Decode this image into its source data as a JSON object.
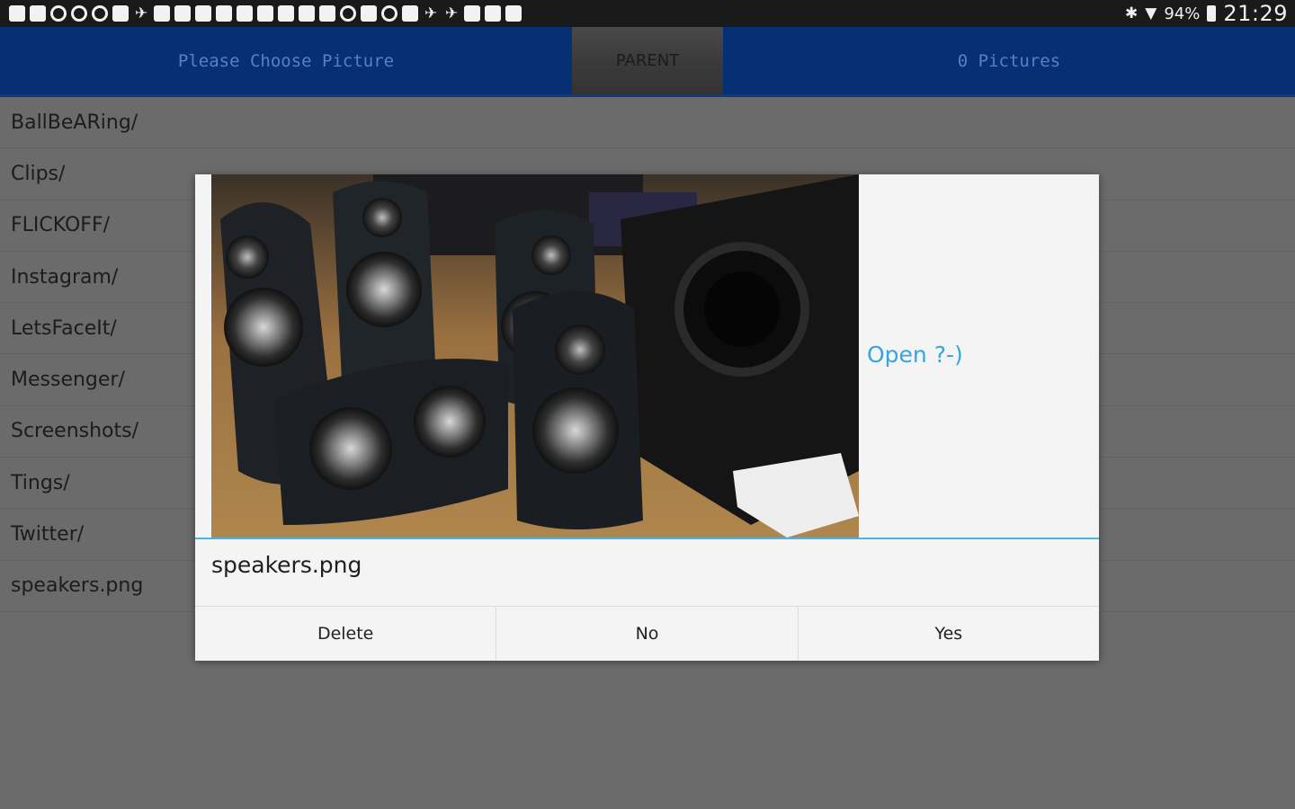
{
  "status_bar": {
    "notification_icons": [
      "app-icon",
      "app-icon",
      "circle-icon",
      "circle-icon",
      "circle-icon",
      "app-icon",
      "twitter-icon",
      "app-icon",
      "app-icon",
      "app-icon",
      "app-icon",
      "app-icon",
      "app-icon",
      "app-icon",
      "app-icon",
      "image-icon",
      "circle-icon",
      "app-icon",
      "circle-icon",
      "app-icon",
      "twitter-icon",
      "twitter-icon",
      "app-icon",
      "app-icon",
      "app-icon"
    ],
    "battery": "94%",
    "time": "21:29"
  },
  "topbar": {
    "title": "Please Choose Picture",
    "parent_label": "PARENT",
    "count_label": "0 Pictures"
  },
  "files": [
    "BallBeARing/",
    "Clips/",
    "FLICKOFF/",
    "Instagram/",
    "LetsFaceIt/",
    "Messenger/",
    "Screenshots/",
    "Tings/",
    "Twitter/",
    "speakers.png"
  ],
  "dialog": {
    "open_label": "Open ?-)",
    "filename": "speakers.png",
    "buttons": {
      "delete": "Delete",
      "no": "No",
      "yes": "Yes"
    }
  },
  "colors": {
    "topbar_bg": "#072f73",
    "accent": "#46b6e4",
    "link": "#35a6dc",
    "overlay_bg": "#6b6b6b"
  }
}
